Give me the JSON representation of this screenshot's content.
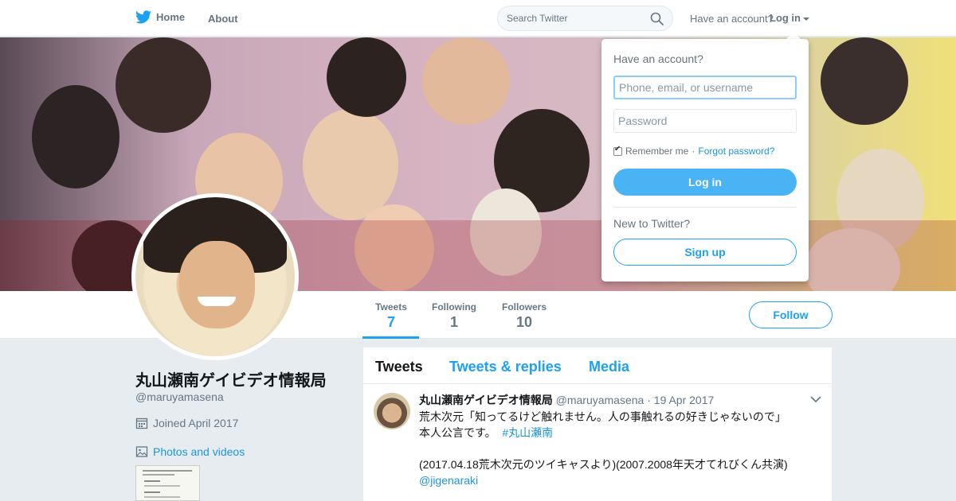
{
  "nav": {
    "home_label": "Home",
    "about_label": "About",
    "search_placeholder": "Search Twitter",
    "have_account": "Have an account?",
    "login_label": "Log in"
  },
  "profile": {
    "name": "丸山瀬南ゲイビデオ情報局",
    "handle": "@maruyamasena",
    "joined": "Joined April 2017",
    "photos_label": "Photos and videos",
    "follow_label": "Follow",
    "stats": [
      {
        "label": "Tweets",
        "value": "7"
      },
      {
        "label": "Following",
        "value": "1"
      },
      {
        "label": "Followers",
        "value": "10"
      }
    ]
  },
  "timeline": {
    "tabs": [
      "Tweets",
      "Tweets & replies",
      "Media"
    ],
    "tweet": {
      "name": "丸山瀬南ゲイビデオ情報局",
      "handle": "@maruyamasena",
      "date": "19 Apr 2017",
      "line1": "荒木次元「知ってるけど触れません。人の事触れるの好きじゃないので」",
      "line2": "本人公言です。",
      "hashtag": "#丸山瀬南",
      "line3": "(2017.04.18荒木次元のツイキャスより)(2007.2008年天才てれびくん共演)",
      "mention": "@jigenaraki"
    }
  },
  "login_dropdown": {
    "title": "Have an account?",
    "username_placeholder": "Phone, email, or username",
    "password_placeholder": "Password",
    "remember": "Remember me",
    "separator": "·",
    "forgot": "Forgot password?",
    "login_button": "Log in",
    "new_to_twitter": "New to Twitter?",
    "signup_button": "Sign up"
  },
  "colors": {
    "brand": "#1da1f2",
    "background": "#e6ecf0"
  },
  "icons": [
    "twitter-bird-icon",
    "search-icon",
    "calendar-icon",
    "photo-icon",
    "chevron-down-icon"
  ]
}
